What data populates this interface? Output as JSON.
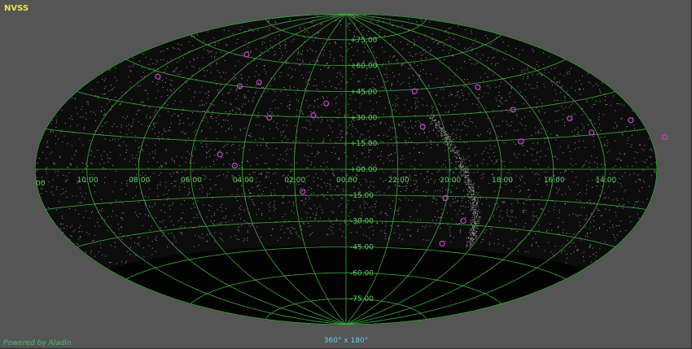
{
  "survey": "NVSS",
  "powered_by": "Powered by Aladin",
  "field_of_view": "360° x 180°",
  "colors": {
    "background": "#555555",
    "sky": "#0d0d0d",
    "grid": "#3fa83f",
    "grid_label": "#5fd15f",
    "survey_label": "#e6e64a",
    "source_marker": "#cc44cc",
    "powered_by": "#4fb870",
    "fov": "#69c9e8"
  },
  "projection": "Aitoff",
  "dec_labels": [
    "+75.00",
    "+60.00",
    "+45.00",
    "+30.00",
    "+15.00",
    "+00.00",
    "-15.00",
    "-30.00",
    "-45.00",
    "-60.00",
    "-75.00"
  ],
  "ra_labels": [
    "00",
    "10:00",
    "08:00",
    "06:00",
    "04:00",
    "02:00",
    "00:00",
    "22:00",
    "20:00",
    "18:00",
    "16:00",
    "14:00"
  ],
  "markers": [
    {
      "ra_h": 6.85,
      "dec": 61
    },
    {
      "ra_h": 9.5,
      "dec": 43
    },
    {
      "ra_h": 5.3,
      "dec": 45
    },
    {
      "ra_h": 4.5,
      "dec": 48
    },
    {
      "ra_h": 3.25,
      "dec": 29
    },
    {
      "ra_h": 1.4,
      "dec": 31
    },
    {
      "ra_h": 0.9,
      "dec": 38
    },
    {
      "ra_h": 12.4,
      "dec": 19
    },
    {
      "ra_h": 4.9,
      "dec": 8
    },
    {
      "ra_h": 4.3,
      "dec": 2
    },
    {
      "ra_h": 1.7,
      "dec": -13
    },
    {
      "ra_h": 20.65,
      "dec": 44
    },
    {
      "ra_h": 20.85,
      "dec": 24
    },
    {
      "ra_h": 17.55,
      "dec": 43
    },
    {
      "ra_h": 16.8,
      "dec": 30
    },
    {
      "ra_h": 17.1,
      "dec": 14
    },
    {
      "ra_h": 14.75,
      "dec": 23
    },
    {
      "ra_h": 14.2,
      "dec": 16
    },
    {
      "ra_h": 20.05,
      "dec": -16
    },
    {
      "ra_h": 19.05,
      "dec": -28
    },
    {
      "ra_h": 19.45,
      "dec": -41
    }
  ]
}
